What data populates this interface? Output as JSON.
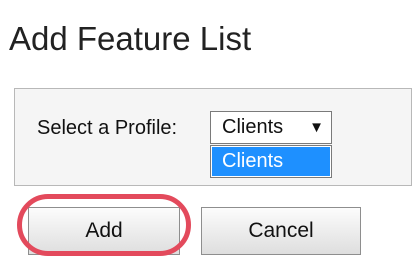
{
  "page": {
    "title": "Add Feature List"
  },
  "profile": {
    "label": "Select a Profile:",
    "selected": "Clients",
    "arrow_icon": "caret-down",
    "options": [
      "Clients"
    ]
  },
  "actions": {
    "add_label": "Add",
    "cancel_label": "Cancel"
  },
  "annotation": {
    "highlight_color": "#e34a5c",
    "highlight_target": "add-button"
  },
  "colors": {
    "option_highlight": "#1e90ff"
  }
}
